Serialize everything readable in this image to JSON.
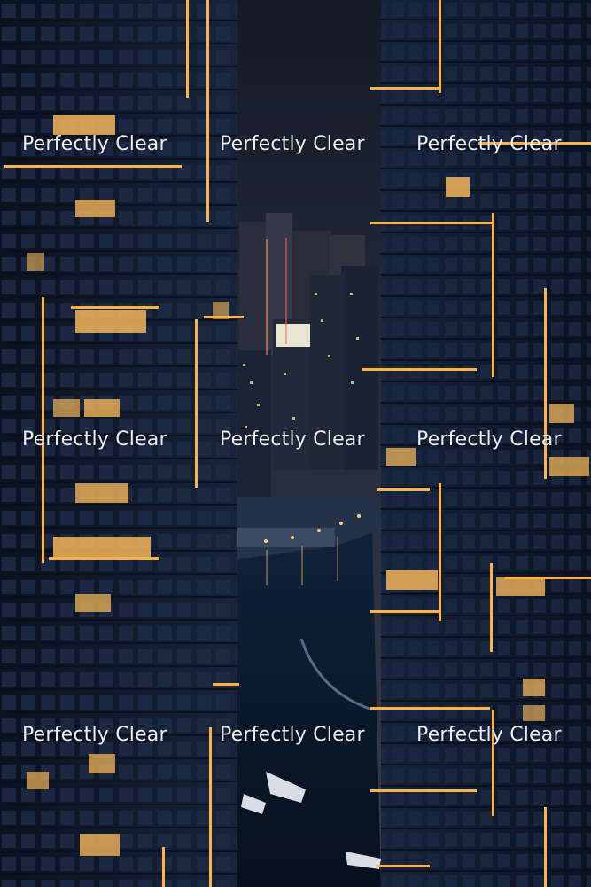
{
  "image": {
    "subject": "night city marina between two glass skyscrapers"
  },
  "watermark": {
    "text": "Perfectly Clear",
    "rows": 3,
    "columns": 3
  },
  "colors": {
    "sky": "#1c2433",
    "tower": "#0f1726",
    "window_light": "#f2b55a",
    "led_strip": "#ffb347",
    "water": "#0e1a2c"
  }
}
